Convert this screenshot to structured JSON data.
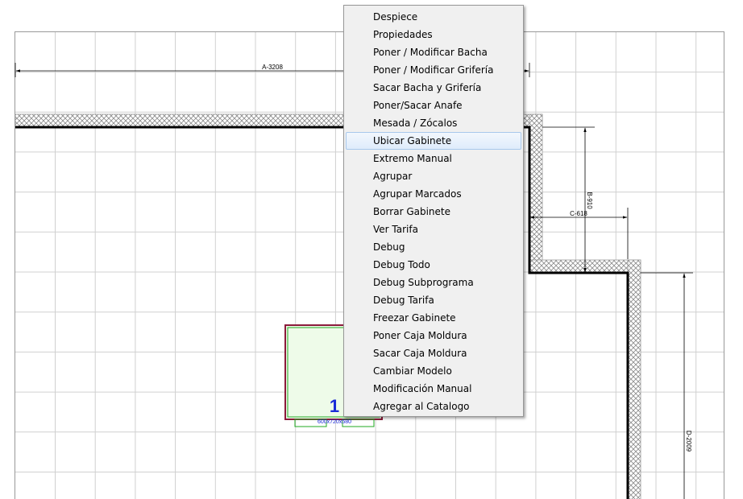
{
  "drawing": {
    "dimensions": {
      "a": "A-3208",
      "b": "B-910",
      "c": "C-618",
      "d": "D-2009"
    },
    "cabinet": {
      "number": "1",
      "size_label": "600x720x580"
    }
  },
  "context_menu": {
    "highlighted_index": 7,
    "items": [
      "Despiece",
      "Propiedades",
      "Poner / Modificar Bacha",
      "Poner / Modificar Grifería",
      "Sacar Bacha y Grifería",
      "Poner/Sacar Anafe",
      "Mesada / Zócalos",
      "Ubicar Gabinete",
      "Extremo Manual",
      "Agrupar",
      "Agrupar Marcados",
      "Borrar Gabinete",
      "Ver Tarifa",
      "Debug",
      "Debug Todo",
      "Debug Subprograma",
      "Debug Tarifa",
      "Freezar Gabinete",
      "Poner Caja Moldura",
      "Sacar Caja Moldura",
      "Cambiar Modelo",
      "Modificación Manual",
      "Agregar al Catalogo"
    ]
  },
  "colors": {
    "grid": "#d0d0d0",
    "wall": "#000000",
    "hatch": "#808080",
    "cabinet_fill": "#eefbe9",
    "cabinet_border": "#8b1a3a",
    "cabinet_inner": "#22aa22",
    "cabinet_number": "#1a2ad8",
    "menu_highlight_border": "#a8c8ec"
  }
}
